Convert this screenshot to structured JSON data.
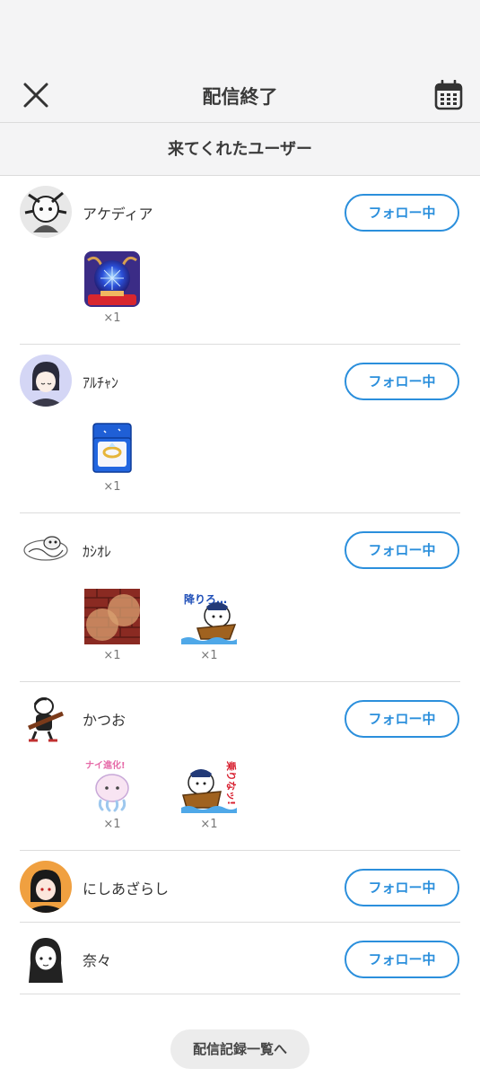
{
  "header": {
    "title": "配信終了"
  },
  "section": {
    "title": "来てくれたユーザー"
  },
  "users": [
    {
      "name": "アケディア",
      "follow_label": "フォロー中",
      "gifts": [
        {
          "icon": "crystal-ball-gift-icon",
          "count": "×1"
        }
      ]
    },
    {
      "name": "ｱﾙﾁｬﾝ",
      "follow_label": "フォロー中",
      "gifts": [
        {
          "icon": "ring-box-gift-icon",
          "count": "×1"
        }
      ]
    },
    {
      "name": "ｶｼｵﾚ",
      "follow_label": "フォロー中",
      "gifts": [
        {
          "icon": "brick-wall-gift-icon",
          "count": "×1"
        },
        {
          "icon": "boat-seal-sticker-icon",
          "label": "降りろ…",
          "count": "×1"
        }
      ]
    },
    {
      "name": "かつお",
      "follow_label": "フォロー中",
      "gifts": [
        {
          "icon": "jellyfish-sticker-icon",
          "label": "ナイ進化!",
          "count": "×1"
        },
        {
          "icon": "boat-seal-sticker-icon",
          "label": "乗りなッ!",
          "count": "×1"
        }
      ]
    },
    {
      "name": "にしあざらし",
      "follow_label": "フォロー中",
      "gifts": []
    },
    {
      "name": "奈々",
      "follow_label": "フォロー中",
      "gifts": []
    }
  ],
  "footer": {
    "history_label": "配信記録一覧へ"
  },
  "colors": {
    "accent": "#2b8fdc",
    "header_bg": "#f4f4f5"
  }
}
